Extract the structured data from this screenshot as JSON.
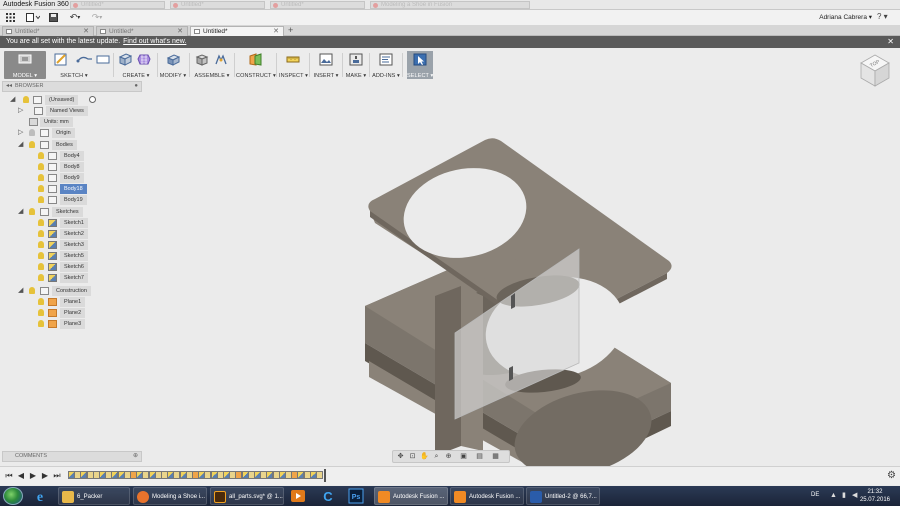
{
  "window": {
    "title": "Autodesk Fusion 360"
  },
  "browser_tabs": [
    {
      "label": "Untitled*"
    },
    {
      "label": "Untitled*"
    },
    {
      "label": "Untitled*"
    },
    {
      "label": "Modeling a Shoe in Fusion"
    }
  ],
  "appbar": {
    "user": "Adriana Cabrera ▾",
    "help": "? ▾"
  },
  "doc_tabs": [
    {
      "label": "Untitled*",
      "active": false
    },
    {
      "label": "Untitled*",
      "active": false
    },
    {
      "label": "Untitled*",
      "active": true
    }
  ],
  "notification": {
    "text": "You are all set with the latest update.",
    "link": "Find out what's new."
  },
  "toolbar": {
    "model": "MODEL ▾",
    "sketch": "SKETCH ▾",
    "create": "CREATE ▾",
    "modify": "MODIFY ▾",
    "assemble": "ASSEMBLE ▾",
    "construct": "CONSTRUCT ▾",
    "inspect": "INSPECT ▾",
    "insert": "INSERT ▾",
    "make": "MAKE ▾",
    "addins": "ADD-INS ▾",
    "select": "SELECT ▾"
  },
  "viewcube": {
    "face": "TOP"
  },
  "browser": {
    "header": "BROWSER",
    "root": "(Unsaved)",
    "named_views": "Named Views",
    "units": "Units: mm",
    "origin": "Origin",
    "bodies": "Bodies",
    "body_items": [
      "Body4",
      "Body8",
      "Body9",
      "Body18",
      "Body19"
    ],
    "selected_body": "Body18",
    "sketches": "Sketches",
    "sketch_items": [
      "Sketch1",
      "Sketch2",
      "Sketch3",
      "Sketch5",
      "Sketch6",
      "Sketch7"
    ],
    "construction": "Construction",
    "plane_items": [
      "Plane1",
      "Plane2",
      "Plane3"
    ]
  },
  "comments": {
    "header": "COMMENTS"
  },
  "taskbar": {
    "items": [
      {
        "label": "6_Packer",
        "color": "#e8b84a"
      },
      {
        "label": "Modeling a Shoe i...",
        "color": "#e8732c"
      },
      {
        "label": "all_parts.svg* @ 1...",
        "color": "#f0a020"
      },
      {
        "label": "Autodesk Fusion ...",
        "color": "#f08a24"
      },
      {
        "label": "Autodesk Fusion ...",
        "color": "#f08a24"
      },
      {
        "label": "Untitled-2 @ 66,7...",
        "color": "#2a5caa"
      }
    ],
    "lang": "DE",
    "time": "21:32",
    "date": "25.07.2016"
  },
  "colors": {
    "part": "#8a8278",
    "part_dark": "#6f675e",
    "part_edge": "#5f584f",
    "selection": "#5a84c4",
    "notification_bg": "#5a5a5a"
  }
}
